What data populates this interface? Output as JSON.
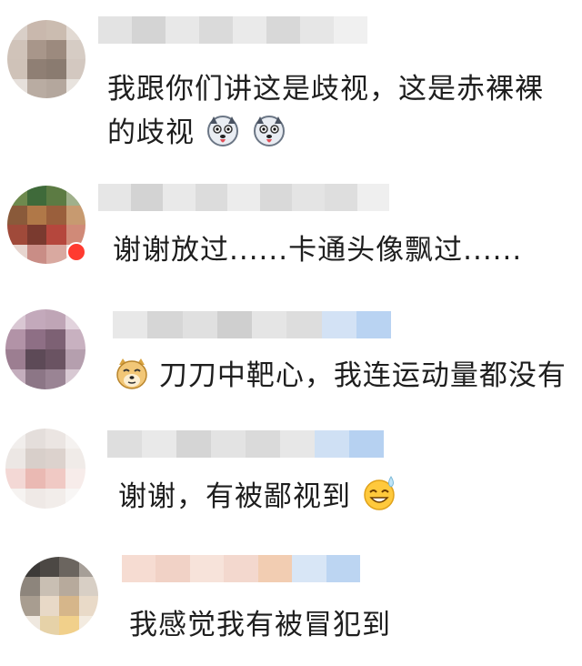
{
  "comments": [
    {
      "text_line1": "我跟你们讲这是歧视，这是赤裸裸",
      "text_line2": "的歧视",
      "emoji": "husky-emoji"
    },
    {
      "text_line1": "谢谢放过......卡通头像飘过......"
    },
    {
      "text_line1": "刀刀中靶心，我连运动量都没有",
      "emoji": "doge-emoji"
    },
    {
      "text_line1": "谢谢，有被鄙视到",
      "emoji": "sweat-smile-emoji"
    },
    {
      "text_line1": "我感觉我有被冒犯到"
    }
  ]
}
